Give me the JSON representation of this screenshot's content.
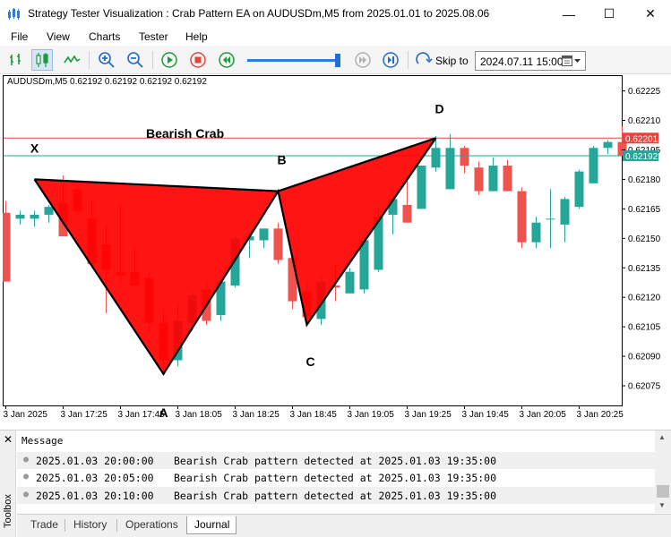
{
  "window": {
    "title": "Strategy Tester Visualization : Crab Pattern EA on AUDUSDm,M5 from 2025.01.01 to 2025.08.06",
    "minimize_glyph": "—",
    "maximize_glyph": "☐",
    "close_glyph": "✕"
  },
  "menu": [
    "File",
    "View",
    "Charts",
    "Tester",
    "Help"
  ],
  "toolbar": {
    "icons": [
      "bar-chart-icon",
      "candlestick-chart-icon",
      "line-chart-icon",
      "zoom-in-icon",
      "zoom-out-icon",
      "play-icon",
      "stop-icon",
      "rewind-icon",
      "step-icon",
      "fast-forward-icon",
      "skip-icon"
    ],
    "speed_level": 0.97,
    "skip_label": "Skip to",
    "skip_date": "2024.07.11 15:00"
  },
  "chart": {
    "symbol_info": "AUDUSDm,M5  0.62192 0.62192 0.62192 0.62192",
    "pattern_label": "Bearish Crab",
    "points": [
      {
        "label": "X",
        "time_index": 2,
        "price": 0.6218
      },
      {
        "label": "A",
        "time_index": 11,
        "price": 0.62081
      },
      {
        "label": "B",
        "time_index": 19,
        "price": 0.62174
      },
      {
        "label": "C",
        "time_index": 21,
        "price": 0.62106
      },
      {
        "label": "D",
        "time_index": 30,
        "price": 0.62201
      }
    ],
    "price_ticks": [
      "0.62225",
      "0.62210",
      "0.62195",
      "0.62180",
      "0.62165",
      "0.62150",
      "0.62135",
      "0.62120",
      "0.62105",
      "0.62090",
      "0.62075"
    ],
    "price_tick_values": [
      0.62225,
      0.6221,
      0.62195,
      0.6218,
      0.62165,
      0.6215,
      0.62135,
      0.6212,
      0.62105,
      0.6209,
      0.62075
    ],
    "time_ticks": [
      "3 Jan 2025",
      "3 Jan 17:25",
      "3 Jan 17:45",
      "3 Jan 18:05",
      "3 Jan 18:25",
      "3 Jan 18:45",
      "3 Jan 19:05",
      "3 Jan 19:25",
      "3 Jan 19:45",
      "3 Jan 20:05",
      "3 Jan 20:25"
    ],
    "level_red": {
      "value": 0.62201,
      "label": "0.62201",
      "color": "#e8423f"
    },
    "level_teal": {
      "value": 0.62192,
      "label": "0.62192",
      "color": "#26a69a"
    },
    "colors": {
      "bull": "#26a69a",
      "bear": "#ef5350",
      "pattern_fill": "#ff0000"
    },
    "price_range": [
      0.62065,
      0.62233
    ],
    "candles": [
      {
        "o": 0.62163,
        "h": 0.62169,
        "l": 0.62128,
        "c": 0.62128
      },
      {
        "o": 0.6216,
        "h": 0.62164,
        "l": 0.62157,
        "c": 0.62162
      },
      {
        "o": 0.6216,
        "h": 0.62164,
        "l": 0.62156,
        "c": 0.62162
      },
      {
        "o": 0.62162,
        "h": 0.62167,
        "l": 0.62158,
        "c": 0.62166
      },
      {
        "o": 0.62168,
        "h": 0.62182,
        "l": 0.62159,
        "c": 0.62151
      },
      {
        "o": 0.62175,
        "h": 0.62179,
        "l": 0.62162,
        "c": 0.62164
      },
      {
        "o": 0.6216,
        "h": 0.6217,
        "l": 0.62135,
        "c": 0.62137
      },
      {
        "o": 0.62147,
        "h": 0.62157,
        "l": 0.62112,
        "c": 0.62134
      },
      {
        "o": 0.62133,
        "h": 0.62167,
        "l": 0.62128,
        "c": 0.62131
      },
      {
        "o": 0.62133,
        "h": 0.62145,
        "l": 0.62126,
        "c": 0.62126
      },
      {
        "o": 0.6213,
        "h": 0.62133,
        "l": 0.62102,
        "c": 0.62107
      },
      {
        "o": 0.62107,
        "h": 0.62114,
        "l": 0.62083,
        "c": 0.62088
      },
      {
        "o": 0.62088,
        "h": 0.62117,
        "l": 0.62085,
        "c": 0.62108
      },
      {
        "o": 0.62107,
        "h": 0.62123,
        "l": 0.62103,
        "c": 0.62121
      },
      {
        "o": 0.62124,
        "h": 0.62128,
        "l": 0.62106,
        "c": 0.62108
      },
      {
        "o": 0.62111,
        "h": 0.6213,
        "l": 0.62108,
        "c": 0.62128
      },
      {
        "o": 0.62126,
        "h": 0.62152,
        "l": 0.62125,
        "c": 0.6215
      },
      {
        "o": 0.62149,
        "h": 0.62152,
        "l": 0.6214,
        "c": 0.62151
      },
      {
        "o": 0.62149,
        "h": 0.62155,
        "l": 0.62145,
        "c": 0.62155
      },
      {
        "o": 0.62155,
        "h": 0.62158,
        "l": 0.62137,
        "c": 0.62139
      },
      {
        "o": 0.6214,
        "h": 0.62142,
        "l": 0.62114,
        "c": 0.62118
      },
      {
        "o": 0.62123,
        "h": 0.62128,
        "l": 0.62108,
        "c": 0.6211
      },
      {
        "o": 0.62109,
        "h": 0.62131,
        "l": 0.62106,
        "c": 0.62128
      },
      {
        "o": 0.62126,
        "h": 0.62137,
        "l": 0.62118,
        "c": 0.62125
      },
      {
        "o": 0.62122,
        "h": 0.62135,
        "l": 0.62122,
        "c": 0.62133
      },
      {
        "o": 0.62124,
        "h": 0.62149,
        "l": 0.62122,
        "c": 0.62149
      },
      {
        "o": 0.62134,
        "h": 0.62166,
        "l": 0.62133,
        "c": 0.62161
      },
      {
        "o": 0.62162,
        "h": 0.62175,
        "l": 0.62152,
        "c": 0.6217
      },
      {
        "o": 0.62167,
        "h": 0.62182,
        "l": 0.62158,
        "c": 0.62158
      },
      {
        "o": 0.62165,
        "h": 0.62187,
        "l": 0.62165,
        "c": 0.62187
      },
      {
        "o": 0.62186,
        "h": 0.62202,
        "l": 0.62184,
        "c": 0.62196
      },
      {
        "o": 0.62175,
        "h": 0.62203,
        "l": 0.62175,
        "c": 0.62196
      },
      {
        "o": 0.62196,
        "h": 0.62197,
        "l": 0.62183,
        "c": 0.62187
      },
      {
        "o": 0.62186,
        "h": 0.62189,
        "l": 0.62172,
        "c": 0.62174
      },
      {
        "o": 0.62174,
        "h": 0.62191,
        "l": 0.62174,
        "c": 0.62187
      },
      {
        "o": 0.62187,
        "h": 0.6219,
        "l": 0.62174,
        "c": 0.62174
      },
      {
        "o": 0.62174,
        "h": 0.62176,
        "l": 0.62145,
        "c": 0.62148
      },
      {
        "o": 0.62148,
        "h": 0.62161,
        "l": 0.62145,
        "c": 0.62158
      },
      {
        "o": 0.6216,
        "h": 0.62175,
        "l": 0.62145,
        "c": 0.6216
      },
      {
        "o": 0.62157,
        "h": 0.62171,
        "l": 0.62148,
        "c": 0.6217
      },
      {
        "o": 0.62166,
        "h": 0.62185,
        "l": 0.62165,
        "c": 0.62184
      },
      {
        "o": 0.62178,
        "h": 0.62197,
        "l": 0.62178,
        "c": 0.62196
      },
      {
        "o": 0.62196,
        "h": 0.622,
        "l": 0.62193,
        "c": 0.62199
      },
      {
        "o": 0.62199,
        "h": 0.62207,
        "l": 0.62192,
        "c": 0.62192
      }
    ]
  },
  "toolbox": {
    "label": "Toolbox",
    "close_glyph": "✕",
    "column_header": "Message",
    "rows": [
      {
        "time": "2025.01.03 20:00:00",
        "message": "Bearish Crab pattern detected at 2025.01.03 19:35:00"
      },
      {
        "time": "2025.01.03 20:05:00",
        "message": "Bearish Crab pattern detected at 2025.01.03 19:35:00"
      },
      {
        "time": "2025.01.03 20:10:00",
        "message": "Bearish Crab pattern detected at 2025.01.03 19:35:00"
      }
    ],
    "tabs": [
      "Trade",
      "History",
      "Operations",
      "Journal"
    ],
    "active_tab": "Journal"
  }
}
